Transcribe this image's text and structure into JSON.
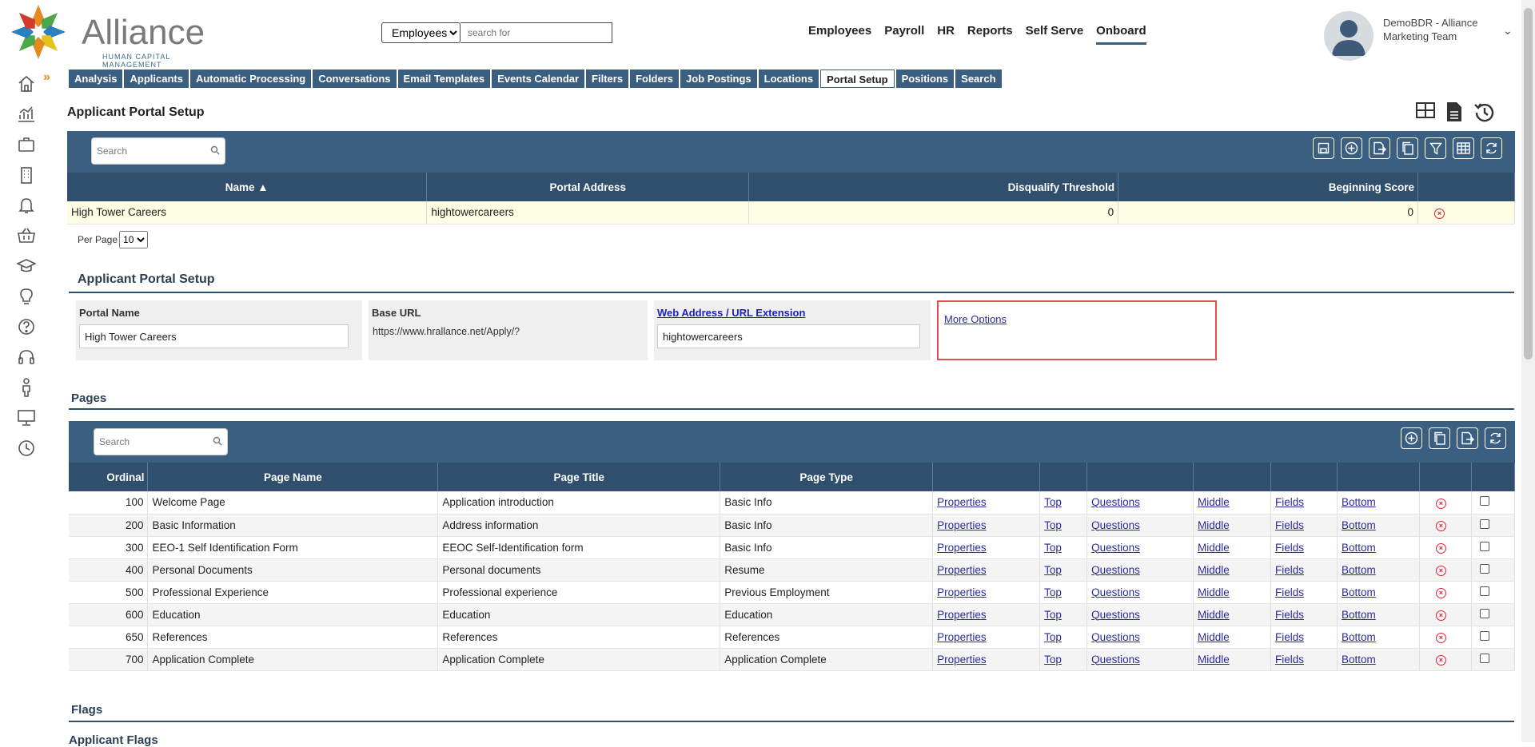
{
  "logo": {
    "brand": "Alliance",
    "subtitle": "HUMAN CAPITAL MANAGEMENT"
  },
  "search": {
    "selected": "Employees",
    "placeholder": "search for"
  },
  "topnav": [
    {
      "label": "Employees"
    },
    {
      "label": "Payroll"
    },
    {
      "label": "HR"
    },
    {
      "label": "Reports"
    },
    {
      "label": "Self Serve"
    },
    {
      "label": "Onboard",
      "active": true
    }
  ],
  "user": {
    "name_line1": "DemoBDR - Alliance",
    "name_line2": "Marketing Team"
  },
  "subtabs": [
    {
      "label": "Analysis"
    },
    {
      "label": "Applicants"
    },
    {
      "label": "Automatic Processing"
    },
    {
      "label": "Conversations"
    },
    {
      "label": "Email Templates"
    },
    {
      "label": "Events Calendar"
    },
    {
      "label": "Filters"
    },
    {
      "label": "Folders"
    },
    {
      "label": "Job Postings"
    },
    {
      "label": "Locations"
    },
    {
      "label": "Portal Setup",
      "active": true
    },
    {
      "label": "Positions"
    },
    {
      "label": "Search"
    }
  ],
  "page_title": "Applicant Portal Setup",
  "portal_grid": {
    "search_placeholder": "Search",
    "columns": [
      "Name ▲",
      "Portal Address",
      "Disqualify Threshold",
      "Beginning Score"
    ],
    "rows": [
      {
        "name": "High Tower Careers",
        "address": "hightowercareers",
        "threshold": "0",
        "score": "0"
      }
    ],
    "per_page_label": "Per Page",
    "per_page_value": "10"
  },
  "setup_form": {
    "title": "Applicant Portal Setup",
    "portal_name_label": "Portal Name",
    "portal_name_value": "High Tower Careers",
    "base_url_label": "Base URL",
    "base_url_value": "https://www.hrallance.net/Apply/?",
    "web_address_label": "Web Address / URL Extension",
    "web_address_value": "hightowercareers",
    "more_options": "More Options"
  },
  "pages_section": {
    "title": "Pages",
    "search_placeholder": "Search",
    "columns": [
      "Ordinal",
      "Page Name",
      "Page Title",
      "Page Type"
    ],
    "link_labels": [
      "Properties",
      "Top",
      "Questions",
      "Middle",
      "Fields",
      "Bottom"
    ],
    "rows": [
      {
        "ordinal": "100",
        "name": "Welcome Page",
        "title": "Application introduction",
        "type": "Basic Info"
      },
      {
        "ordinal": "200",
        "name": "Basic Information",
        "title": "Address information",
        "type": "Basic Info"
      },
      {
        "ordinal": "300",
        "name": "EEO-1 Self Identification Form",
        "title": "EEOC Self-Identification form",
        "type": "Basic Info"
      },
      {
        "ordinal": "400",
        "name": "Personal Documents",
        "title": "Personal documents",
        "type": "Resume"
      },
      {
        "ordinal": "500",
        "name": "Professional Experience",
        "title": "Professional experience",
        "type": "Previous Employment"
      },
      {
        "ordinal": "600",
        "name": "Education",
        "title": "Education",
        "type": "Education"
      },
      {
        "ordinal": "650",
        "name": "References",
        "title": "References",
        "type": "References"
      },
      {
        "ordinal": "700",
        "name": "Application Complete",
        "title": "Application Complete",
        "type": "Application Complete"
      }
    ]
  },
  "flags_section": {
    "title": "Flags",
    "subtitle": "Applicant Flags"
  },
  "colors": {
    "header_bar": "#3b5f80",
    "grid_header": "#2f4f6d",
    "accent": "#e58a1f",
    "highlight_box": "#e05050"
  }
}
